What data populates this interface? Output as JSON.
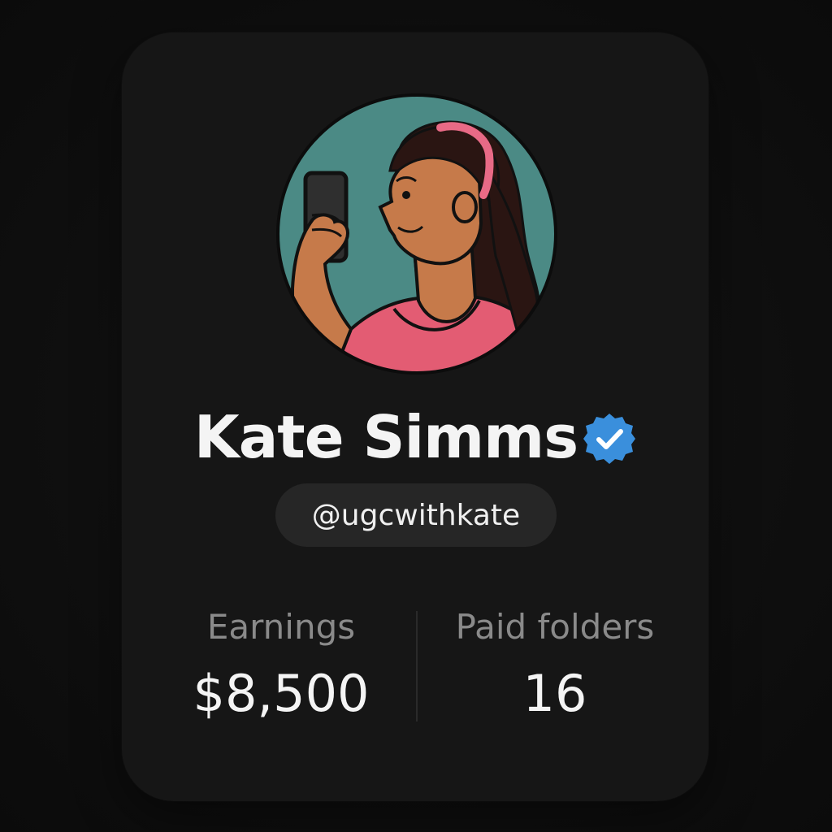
{
  "profile": {
    "name": "Kate Simms",
    "handle": "@ugcwithkate",
    "verified": true,
    "avatar_icon": "woman-holding-phone-avatar",
    "verified_icon": "verified-badge-icon"
  },
  "stats": {
    "earnings": {
      "label": "Earnings",
      "value": "$8,500"
    },
    "paid_folders": {
      "label": "Paid folders",
      "value": "16"
    }
  },
  "colors": {
    "background": "#0f0f0f",
    "card": "#161616",
    "pill": "#262626",
    "text_primary": "#f4f4f4",
    "text_secondary": "#8a8a8a",
    "verified_blue": "#3a8fdc",
    "avatar_bg": "#4b8a85",
    "shirt": "#e35c73",
    "headband": "#e86a86",
    "skin": "#c67a4a",
    "hair": "#2a1512"
  }
}
